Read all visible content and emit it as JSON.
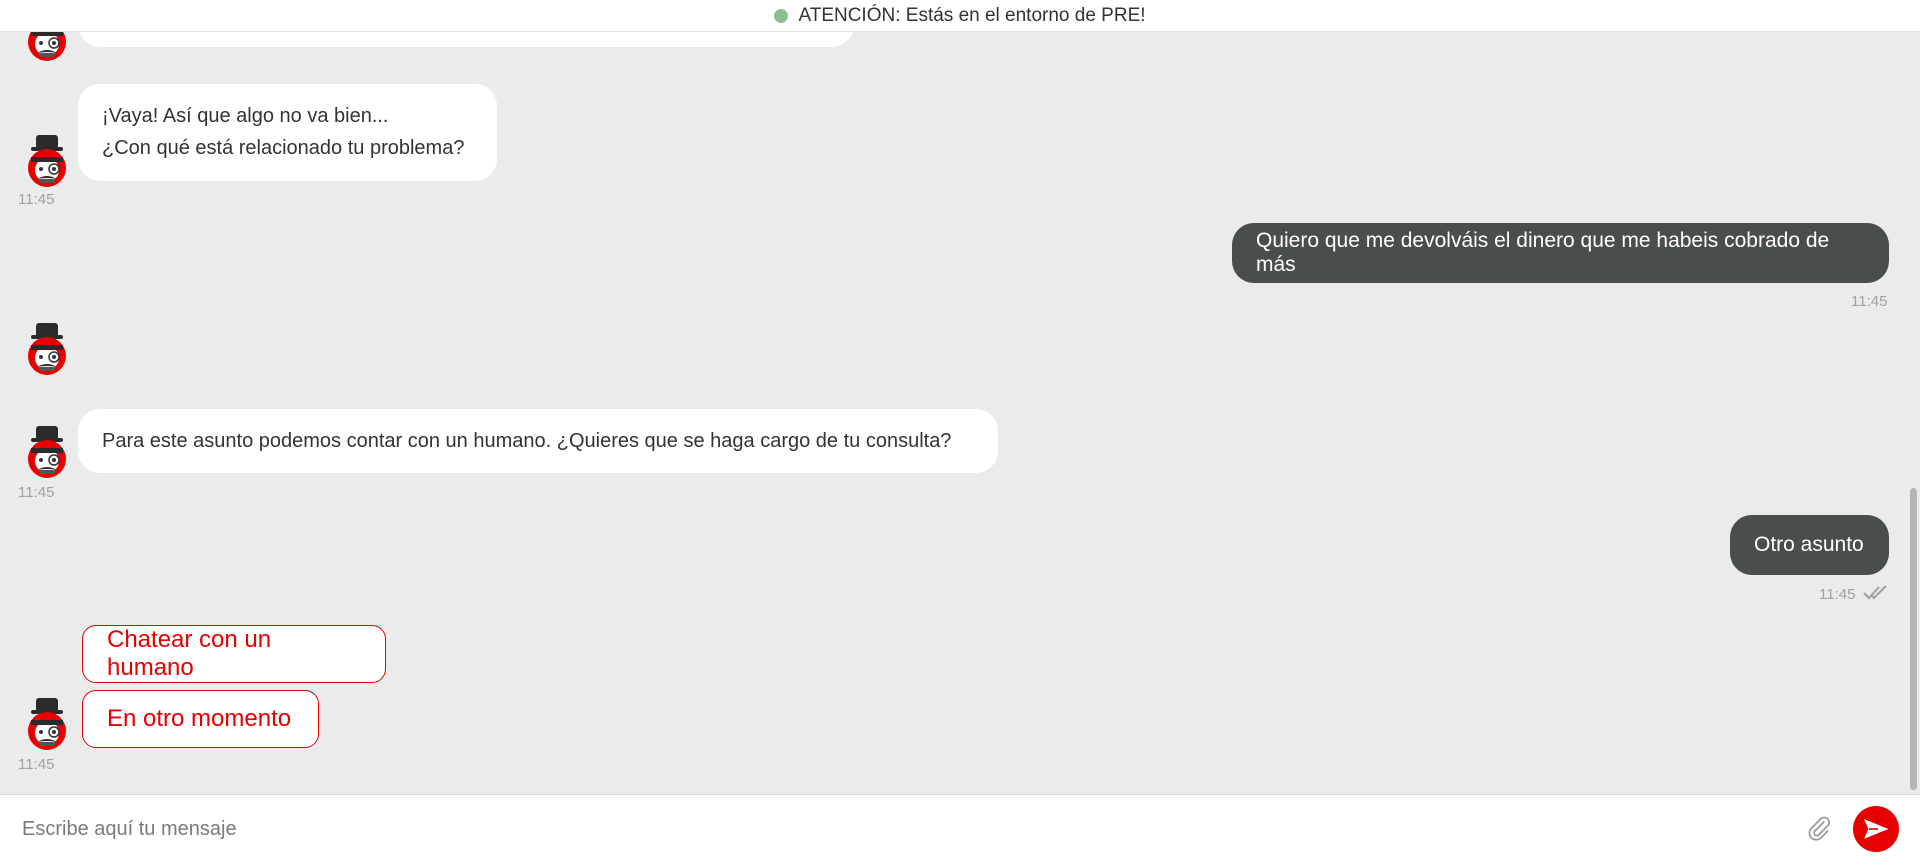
{
  "banner": {
    "text": "ATENCIÓN: Estás en el entorno de PRE!",
    "status_color": "#8fbf8f"
  },
  "messages": {
    "bot_1": {
      "line1": "¡Vaya! Así que algo no va bien...",
      "line2": "¿Con qué está relacionado tu problema?",
      "time": "11:45"
    },
    "user_1": {
      "text": "Quiero que me devolváis el dinero que me habeis cobrado de más",
      "time": "11:45"
    },
    "bot_2": {
      "text": "Para este asunto podemos contar con un humano. ¿Quieres que se haga cargo de tu consulta?",
      "time": "11:45"
    },
    "user_2": {
      "text": "Otro asunto",
      "time": "11:45"
    },
    "bot_3": {
      "time": "11:45"
    }
  },
  "quick_replies": [
    {
      "label": "Chatear con un humano"
    },
    {
      "label": "En otro momento"
    }
  ],
  "composer": {
    "placeholder": "Escribe aquí tu mensaje",
    "attach_icon": "paperclip-icon",
    "send_icon": "send-icon"
  },
  "colors": {
    "accent": "#e60000",
    "user_bubble": "#4a4d4e",
    "background": "#ebebeb"
  }
}
